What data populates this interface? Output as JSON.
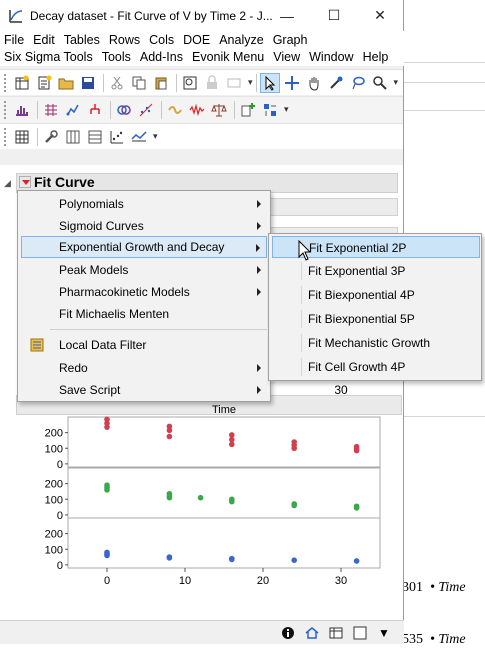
{
  "window": {
    "title": "Decay dataset - Fit Curve of V by Time 2 - J...",
    "minimize": "—",
    "maximize": "☐",
    "close": "✕"
  },
  "menubar": [
    "File",
    "Edit",
    "Tables",
    "Rows",
    "Cols",
    "DOE",
    "Analyze",
    "Graph",
    "Six Sigma Tools",
    "Tools",
    "Add-Ins",
    "Evonik Menu",
    "View",
    "Window",
    "Help"
  ],
  "report": {
    "outline_title": "Fit Curve"
  },
  "context_menu": {
    "items": [
      {
        "label": "Polynomials",
        "submenu": true
      },
      {
        "label": "Sigmoid Curves",
        "submenu": true
      },
      {
        "label": "Exponential Growth and Decay",
        "submenu": true,
        "highlighted": true
      },
      {
        "label": "Peak Models",
        "submenu": true
      },
      {
        "label": "Pharmacokinetic Models",
        "submenu": true
      },
      {
        "label": "Fit Michaelis Menten",
        "submenu": false
      },
      {
        "label": "Local Data Filter",
        "submenu": false,
        "icon": "filter-icon"
      },
      {
        "label": "Redo",
        "submenu": true
      },
      {
        "label": "Save Script",
        "submenu": true
      }
    ]
  },
  "submenu": {
    "items": [
      {
        "label": "Fit Exponential 2P",
        "highlighted": true
      },
      {
        "label": "Fit Exponential 3P"
      },
      {
        "label": "Fit Biexponential 4P"
      },
      {
        "label": "Fit Biexponential 5P"
      },
      {
        "label": "Fit Mechanistic Growth"
      },
      {
        "label": "Fit Cell Growth 4P"
      }
    ]
  },
  "background_window": {
    "text_1": "301",
    "text_2": "• Time",
    "text_3": "535",
    "text_4": "• Time"
  },
  "chart_data": {
    "type": "scatter",
    "xlabel": "Time",
    "x_ticks": [
      0,
      10,
      20,
      30
    ],
    "xlim": [
      -5,
      35
    ],
    "panels": [
      {
        "color": "#d0404f",
        "y_ticks": [
          0,
          100,
          200
        ],
        "ylim": [
          -20,
          300
        ],
        "points": [
          [
            0,
            285
          ],
          [
            0,
            260
          ],
          [
            0,
            235
          ],
          [
            8,
            240
          ],
          [
            8,
            215
          ],
          [
            8,
            175
          ],
          [
            16,
            185
          ],
          [
            16,
            155
          ],
          [
            16,
            125
          ],
          [
            24,
            140
          ],
          [
            24,
            120
          ],
          [
            24,
            100
          ],
          [
            32,
            110
          ],
          [
            32,
            95
          ],
          [
            32,
            85
          ]
        ]
      },
      {
        "color": "#3aa84a",
        "y_ticks": [
          0,
          100,
          200
        ],
        "ylim": [
          -20,
          300
        ],
        "points": [
          [
            0,
            190
          ],
          [
            0,
            175
          ],
          [
            0,
            160
          ],
          [
            8,
            135
          ],
          [
            8,
            120
          ],
          [
            8,
            110
          ],
          [
            12,
            110
          ],
          [
            16,
            100
          ],
          [
            16,
            85
          ],
          [
            24,
            70
          ],
          [
            24,
            60
          ],
          [
            32,
            55
          ],
          [
            32,
            45
          ]
        ]
      },
      {
        "color": "#3a66d0",
        "y_ticks": [
          0,
          100,
          200
        ],
        "ylim": [
          -20,
          300
        ],
        "points": [
          [
            0,
            80
          ],
          [
            0,
            70
          ],
          [
            0,
            60
          ],
          [
            8,
            50
          ],
          [
            8,
            45
          ],
          [
            16,
            40
          ],
          [
            16,
            35
          ],
          [
            24,
            30
          ],
          [
            32,
            25
          ]
        ]
      }
    ],
    "partial_tick_label_above": "30"
  },
  "statusbar": {
    "icons": [
      "info-icon",
      "home-icon",
      "table-icon",
      "checkbox-icon",
      "dropdown-icon"
    ]
  }
}
